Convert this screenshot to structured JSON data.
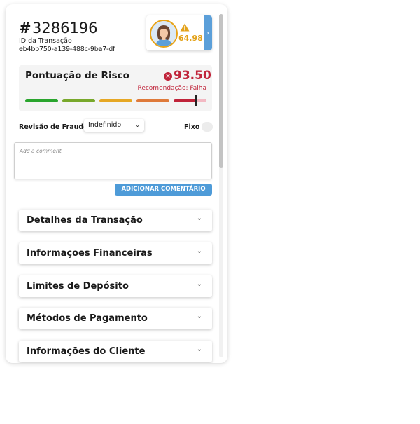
{
  "transaction": {
    "hash_symbol": "#",
    "number": "3286196",
    "id_label": "ID da Transação",
    "id_value": "eb4bb750-a139-488c-9ba7-df"
  },
  "user": {
    "score": "64.98",
    "warning_icon": "warning-triangle-icon",
    "arrow_icon": "chevron-right-icon",
    "arrow_glyph": "›"
  },
  "risk": {
    "title": "Pontuação de Risco",
    "score": "93.50",
    "score_icon_glyph": "×",
    "recommendation": "Recomendação: Falha",
    "level_percent": 94,
    "colors": [
      "#2aa52e",
      "#78a82b",
      "#e6a724",
      "#df7a3a",
      "#c0243a"
    ],
    "score_color": "#c0243a"
  },
  "fraud_review": {
    "label": "Revisão de Fraude",
    "selected": "Indefinido",
    "chevron_glyph": "⌄"
  },
  "fixo": {
    "label": "Fixo",
    "checked": false
  },
  "comment": {
    "placeholder": "Add a comment",
    "button_label": "ADICIONAR COMENTÁRIO"
  },
  "sections": [
    {
      "title": "Detalhes da Transação"
    },
    {
      "title": "Informações Financeiras"
    },
    {
      "title": "Limites de Depósito"
    },
    {
      "title": "Métodos de Pagamento"
    },
    {
      "title": "Informações do Cliente"
    }
  ],
  "section_chevron_glyph": "⌄",
  "accent_color": "#4e9bd8"
}
